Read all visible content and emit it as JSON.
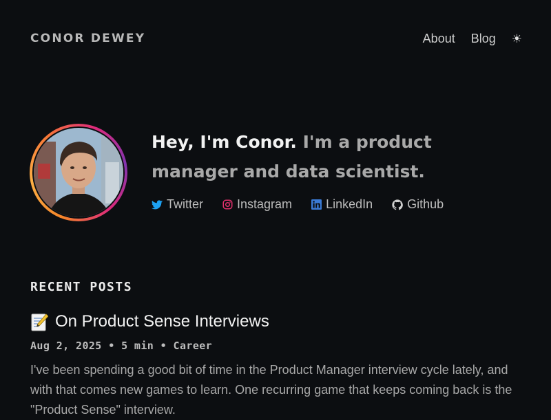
{
  "header": {
    "brand": "CONOR DEWEY",
    "nav": [
      {
        "label": "About"
      },
      {
        "label": "Blog"
      }
    ],
    "theme_toggle_icon": "sun-icon"
  },
  "hero": {
    "intro": "Hey, I'm Conor.",
    "tagline": "I'm a product manager and data scientist.",
    "socials": [
      {
        "label": "Twitter",
        "icon": "twitter-icon",
        "color": "#1da1f2"
      },
      {
        "label": "Instagram",
        "icon": "instagram-icon",
        "color": "#e1306c"
      },
      {
        "label": "LinkedIn",
        "icon": "linkedin-icon",
        "color": "#3b7bd6"
      },
      {
        "label": "Github",
        "icon": "github-icon",
        "color": "#d0d0d0"
      }
    ]
  },
  "recent_posts": {
    "title": "RECENT POSTS",
    "posts": [
      {
        "emoji": "memo-icon",
        "title": "On Product Sense Interviews",
        "date": "Aug 2, 2025",
        "read_time": "5 min",
        "category": "Career",
        "separator": "•",
        "excerpt": "I've been spending a good bit of time in the Product Manager interview cycle lately, and with that comes new games to learn. One recurring game that keeps coming back is the \"Product Sense\" interview."
      }
    ]
  },
  "colors": {
    "background": "#0c0e11",
    "text": "#e6e6e6",
    "muted": "#a9a9a9"
  }
}
